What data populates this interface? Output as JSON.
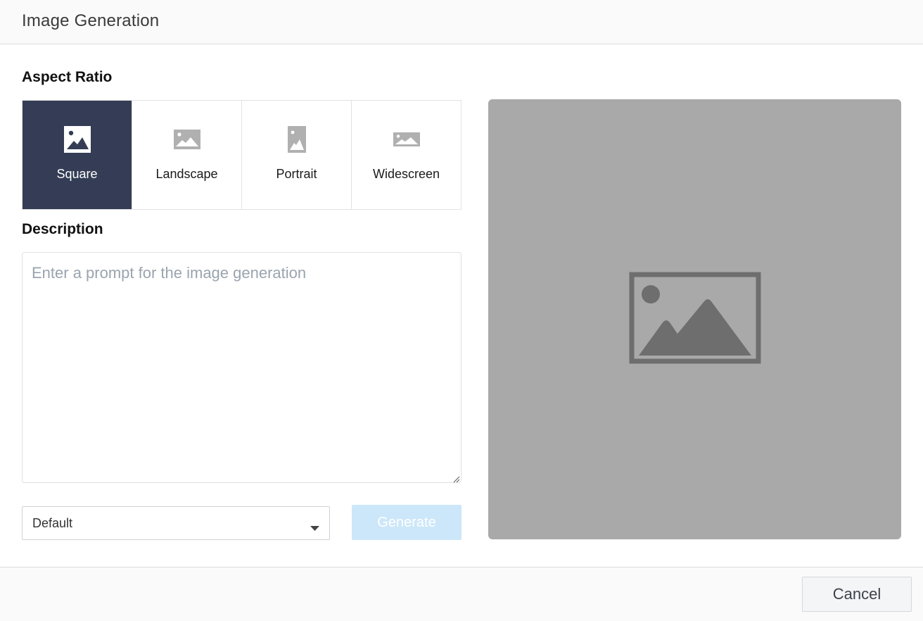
{
  "dialog": {
    "title": "Image Generation"
  },
  "aspect_ratio": {
    "label": "Aspect Ratio",
    "selected": "Square",
    "options": [
      {
        "label": "Square",
        "icon": "square-image-icon"
      },
      {
        "label": "Landscape",
        "icon": "landscape-image-icon"
      },
      {
        "label": "Portrait",
        "icon": "portrait-image-icon"
      },
      {
        "label": "Widescreen",
        "icon": "widescreen-image-icon"
      }
    ]
  },
  "description": {
    "label": "Description",
    "value": "",
    "placeholder": "Enter a prompt for the image generation"
  },
  "style_select": {
    "value": "Default"
  },
  "buttons": {
    "generate": "Generate",
    "cancel": "Cancel"
  },
  "preview": {
    "icon": "image-placeholder-icon"
  },
  "colors": {
    "selected_bg": "#343d55",
    "icon_inactive": "#b0b0b0",
    "generate_disabled": "#cce7f9",
    "preview_bg": "#a9a9a9",
    "preview_icon": "#6e6e6e"
  }
}
